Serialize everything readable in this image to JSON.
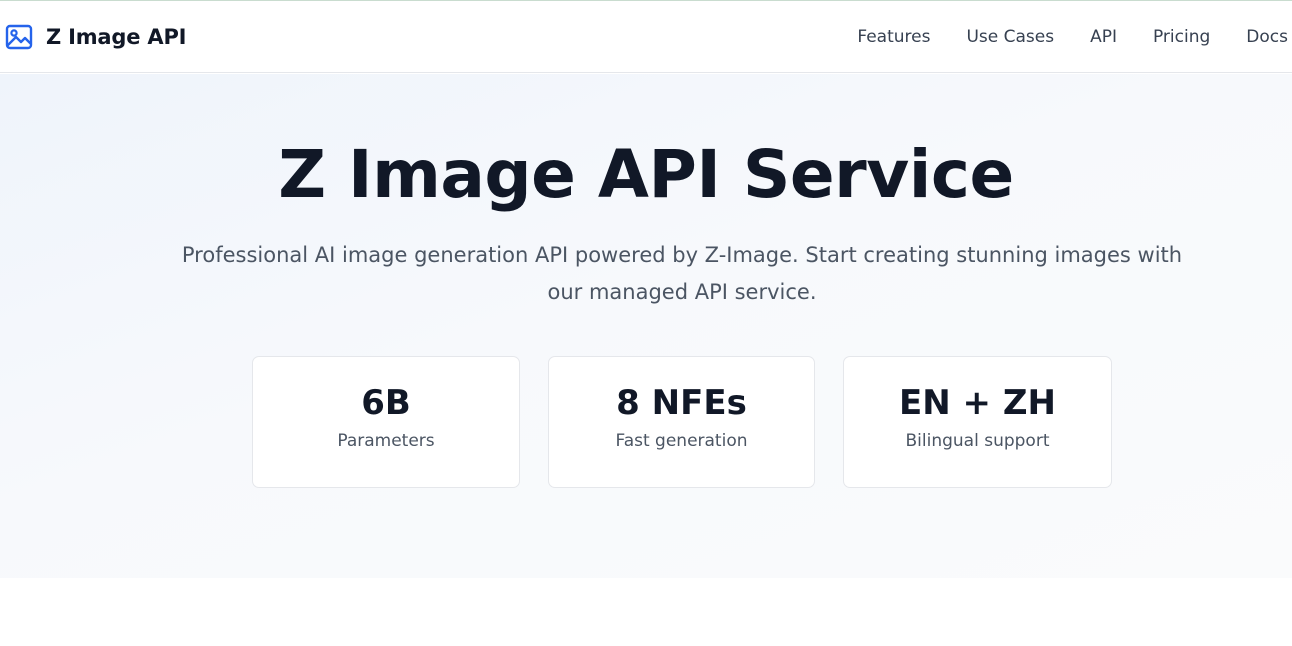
{
  "brand": {
    "name": "Z Image API",
    "icon": "image-icon",
    "accent": "#2563eb"
  },
  "nav": {
    "links": [
      "Features",
      "Use Cases",
      "API",
      "Pricing",
      "Docs"
    ]
  },
  "hero": {
    "title": "Z Image API Service",
    "subtitle": "Professional AI image generation API powered by Z-Image. Start creating stunning images with our managed API service."
  },
  "stats": [
    {
      "value": "6B",
      "label": "Parameters"
    },
    {
      "value": "8 NFEs",
      "label": "Fast generation"
    },
    {
      "value": "EN + ZH",
      "label": "Bilingual support"
    }
  ]
}
